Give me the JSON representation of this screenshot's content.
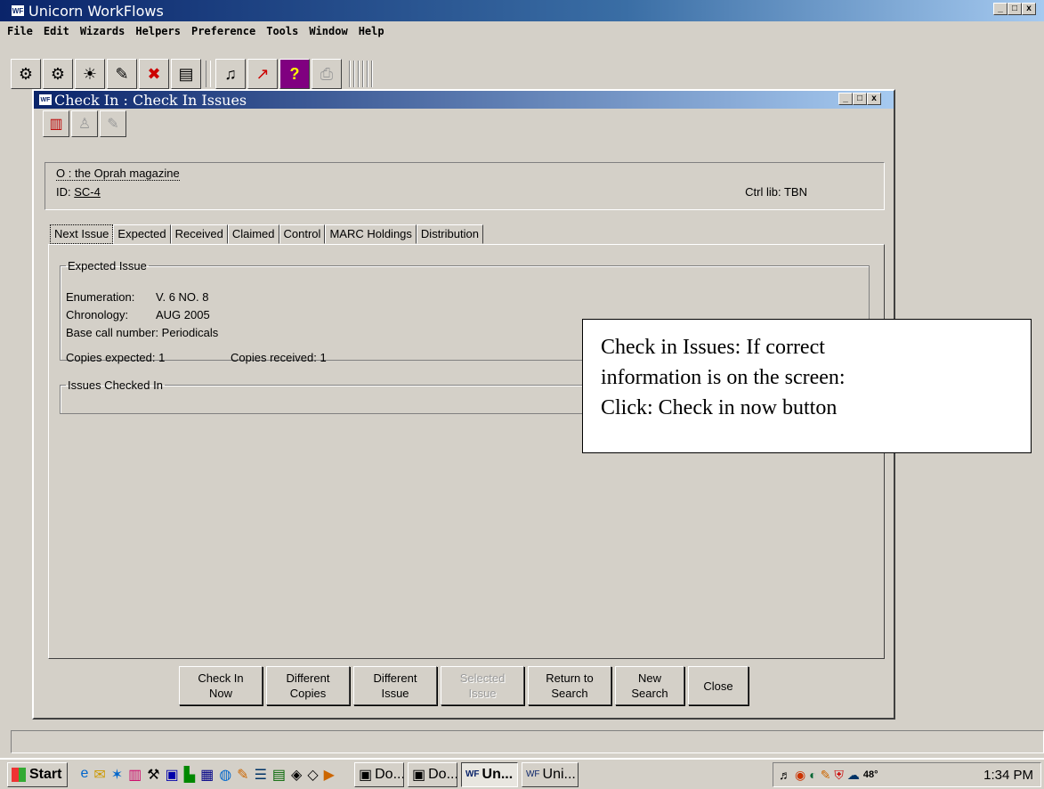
{
  "app": {
    "title": "Unicorn WorkFlows",
    "logo_text": "WF",
    "menu": [
      "File",
      "Edit",
      "Wizards",
      "Helpers",
      "Preference",
      "Tools",
      "Window",
      "Help"
    ],
    "window_controls": [
      "_",
      "□",
      "x"
    ]
  },
  "toolbar": {
    "icons": [
      "user-search-icon",
      "add-user-icon",
      "circulation-icon",
      "checkin-icon",
      "cancel-icon",
      "notice-icon",
      "headphones-icon",
      "report-icon",
      "help-icon",
      "print-icon"
    ]
  },
  "child_window": {
    "title": "Check In : Check In Issues",
    "tools": [
      "book-icon",
      "search-person-icon",
      "edit-icon"
    ],
    "info": {
      "title_line": "O : the Oprah magazine",
      "id_label": "ID:",
      "id_value": "SC-4",
      "ctrl_lib": "Ctrl lib: TBN"
    },
    "tabs": [
      "Next Issue",
      "Expected",
      "Received",
      "Claimed",
      "Control",
      "MARC Holdings",
      "Distribution"
    ],
    "expected_issue": {
      "legend": "Expected Issue",
      "enumeration_label": "Enumeration:",
      "enumeration_value": "V. 6 NO. 8",
      "chronology_label": "Chronology:",
      "chronology_value": "AUG 2005",
      "base_call": "Base call number: Periodicals",
      "copies_expected": "Copies expected: 1",
      "copies_received": "Copies received: 1"
    },
    "issues_checked_in": {
      "legend": "Issues Checked In"
    },
    "buttons": {
      "check_in_now": "Check In\nNow",
      "different_copies": "Different\nCopies",
      "different_issue": "Different\nIssue",
      "selected_issue": "Selected\nIssue",
      "return_to_search": "Return to\nSearch",
      "new_search": "New\nSearch",
      "close": "Close"
    }
  },
  "callout": {
    "line1": "Check in Issues: If correct",
    "line2": "information is on the screen:",
    "line3": "Click: Check in now button"
  },
  "taskbar": {
    "start": "Start",
    "tasks": [
      "Do...",
      "Do...",
      "Un...",
      "Uni..."
    ],
    "clock": "1:34 PM",
    "tray_temp": "48°"
  }
}
